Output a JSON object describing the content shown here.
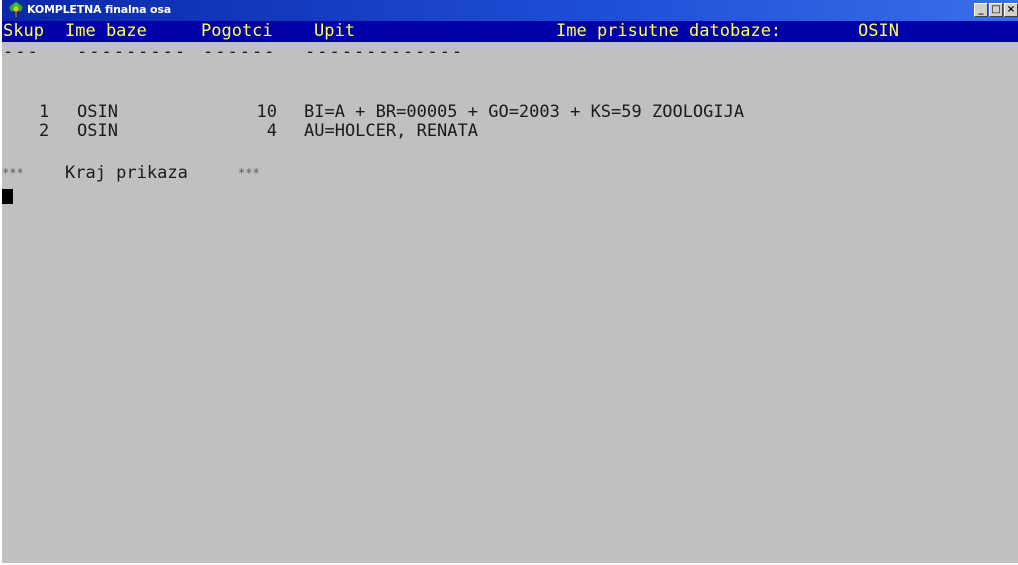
{
  "window": {
    "title": "KOMPLETNA finalna osa",
    "controls": {
      "minimize": "_",
      "maximize": "□",
      "close": "×"
    }
  },
  "header": {
    "col_skup": "Skup",
    "col_ime_baze": "Ime baze",
    "col_pogotci": "Pogotci",
    "col_upit": "Upit",
    "active_db_label": "Ime prisutne datobaze:",
    "active_db_value": "OSIN"
  },
  "separators": {
    "skup": "---",
    "ime_baze": "---------",
    "pogotci": "------",
    "upit": "-------------"
  },
  "rows": [
    {
      "skup": "1",
      "ime_baze": "OSIN",
      "pogotci": "10",
      "upit": "BI=A + BR=00005 + GO=2003 + KS=59 ZOOLOGIJA"
    },
    {
      "skup": "2",
      "ime_baze": "OSIN",
      "pogotci": "4",
      "upit": "AU=HOLCER, RENATA"
    }
  ],
  "footer": {
    "stars_left": "***",
    "message": "Kraj prikaza",
    "stars_right": "***"
  }
}
